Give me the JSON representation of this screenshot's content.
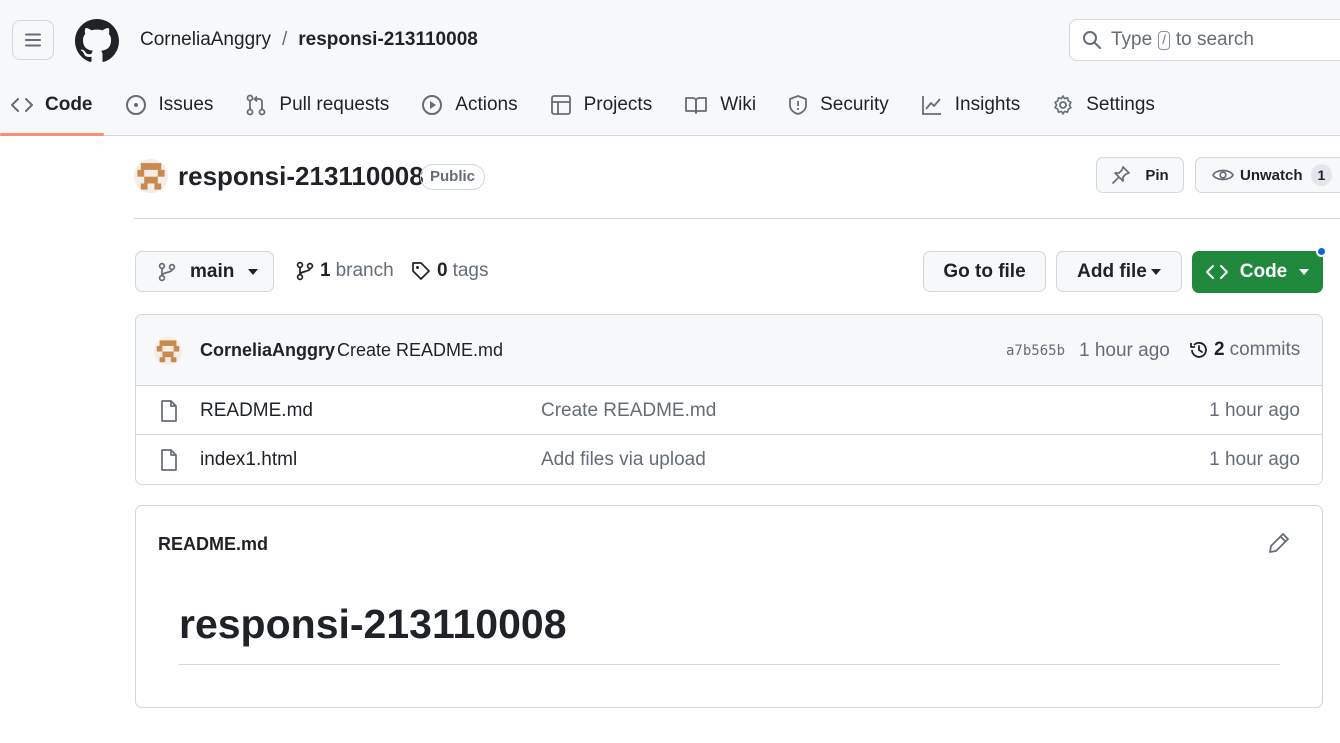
{
  "header": {
    "owner": "CorneliaAnggry",
    "separator": "/",
    "repo": "responsi-213110008",
    "search": {
      "before": "Type",
      "key": "/",
      "after": "to search"
    }
  },
  "tabs": [
    {
      "label": "Code",
      "icon": "code-icon",
      "active": true
    },
    {
      "label": "Issues",
      "icon": "issue-icon"
    },
    {
      "label": "Pull requests",
      "icon": "pull-request-icon"
    },
    {
      "label": "Actions",
      "icon": "play-icon"
    },
    {
      "label": "Projects",
      "icon": "table-icon"
    },
    {
      "label": "Wiki",
      "icon": "book-icon"
    },
    {
      "label": "Security",
      "icon": "shield-icon"
    },
    {
      "label": "Insights",
      "icon": "graph-icon"
    },
    {
      "label": "Settings",
      "icon": "gear-icon"
    }
  ],
  "repo_header": {
    "name": "responsi-213110008",
    "visibility": "Public",
    "pin_label": "Pin",
    "watch_label": "Unwatch",
    "watch_count": "1"
  },
  "toolbar": {
    "branch": "main",
    "branch_count": "1",
    "branch_word": "branch",
    "tag_count": "0",
    "tag_word": "tags",
    "goto_label": "Go to file",
    "addfile_label": "Add file",
    "code_label": "Code"
  },
  "latest_commit": {
    "author": "CorneliaAnggry",
    "message": "Create README.md",
    "sha": "a7b565b",
    "time": "1 hour ago",
    "commit_count": "2",
    "commit_word": "commits"
  },
  "files": [
    {
      "name": "README.md",
      "message": "Create README.md",
      "time": "1 hour ago"
    },
    {
      "name": "index1.html",
      "message": "Add files via upload",
      "time": "1 hour ago"
    }
  ],
  "readme": {
    "label": "README.md",
    "heading": "responsi-213110008"
  },
  "colors": {
    "accent_underline": "#fd8c73",
    "primary_button": "#1f883d",
    "notification_dot": "#0969da"
  }
}
